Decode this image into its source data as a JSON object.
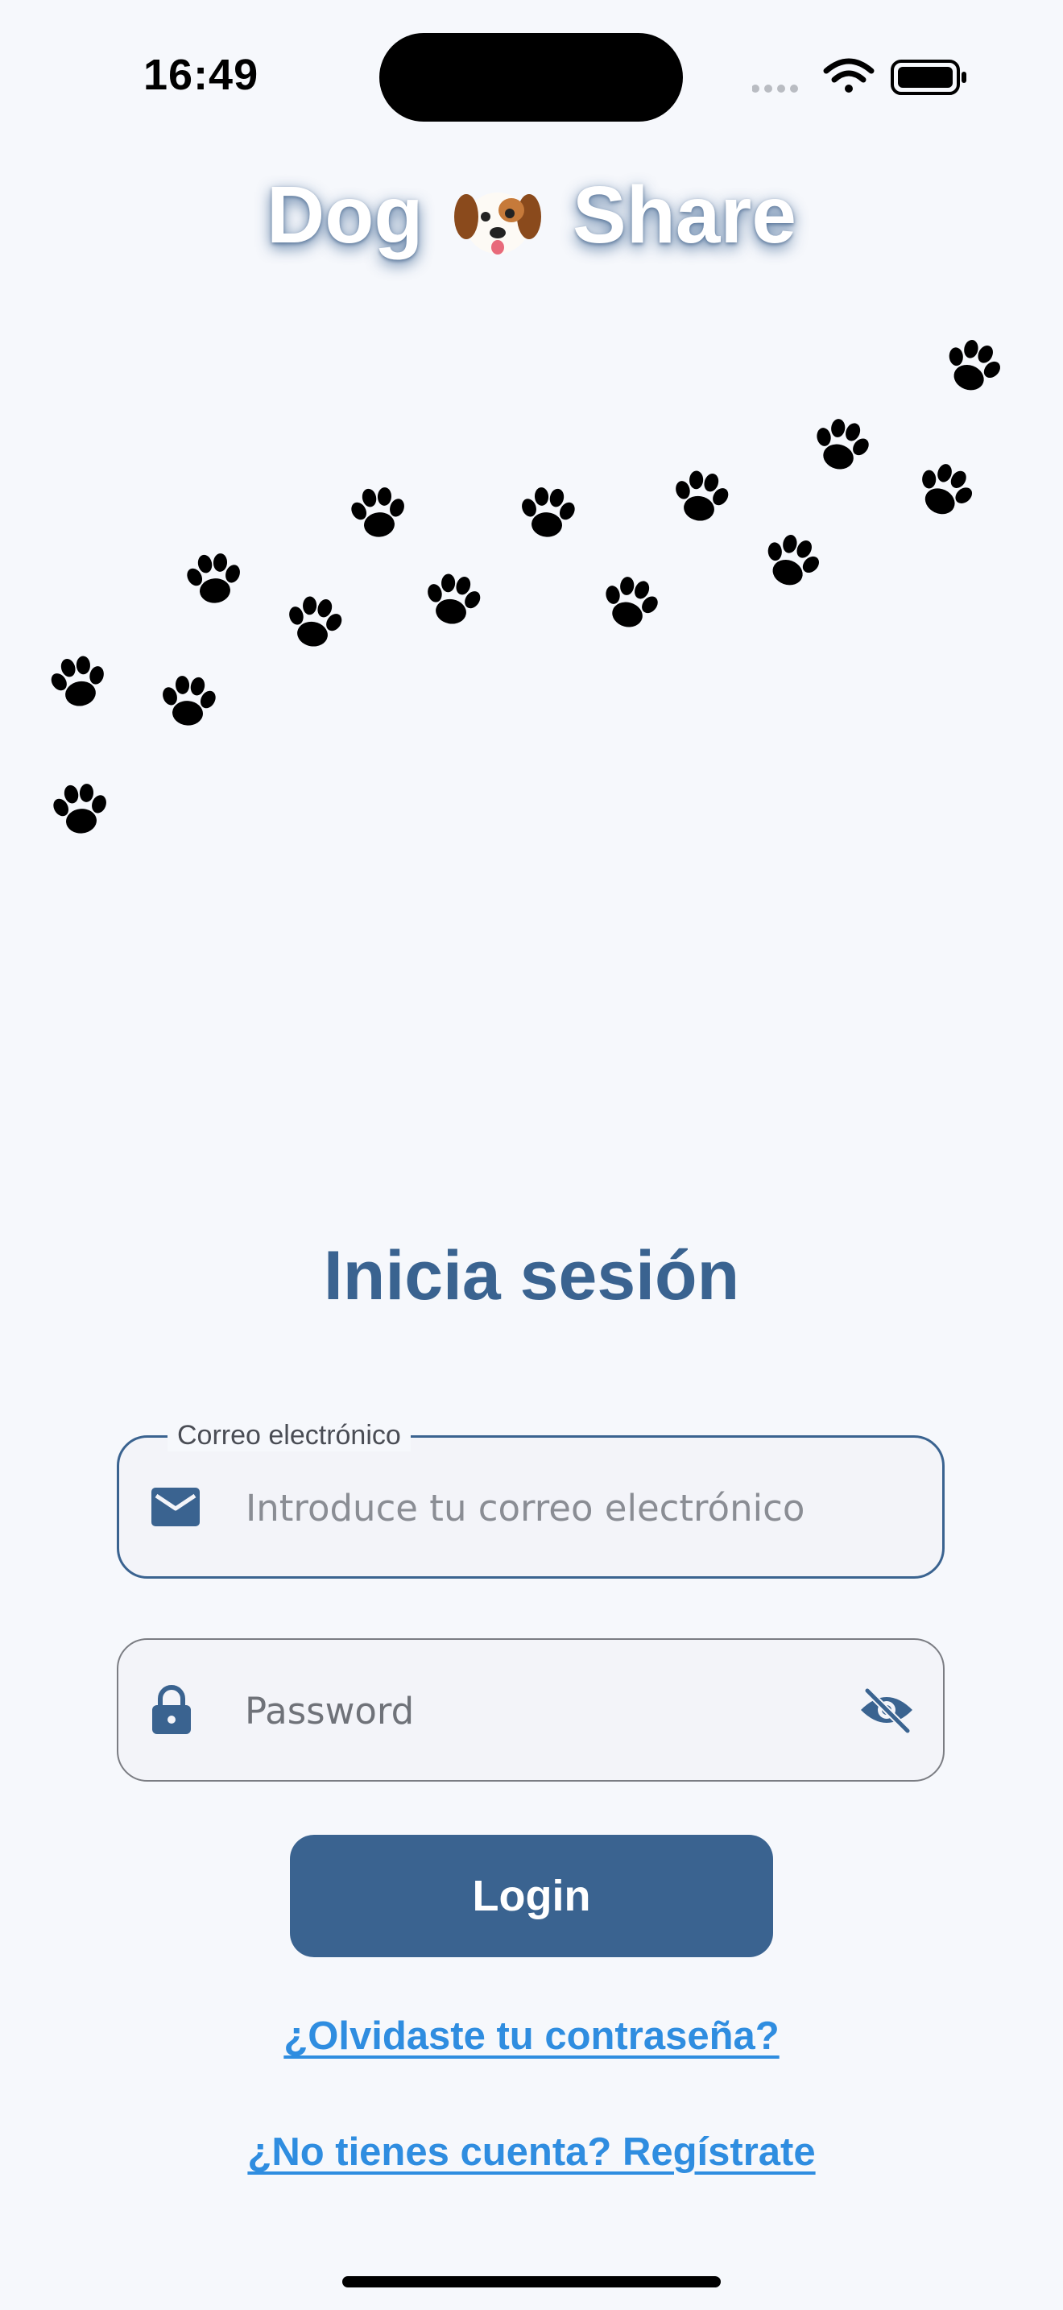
{
  "status_bar": {
    "time": "16:49",
    "icons": [
      "signal-dots-icon",
      "wifi-icon",
      "battery-icon"
    ]
  },
  "app": {
    "title_left": "Dog",
    "title_right": "Share",
    "title_emoji": "dog-face-icon",
    "decoration": "paw-prints-icon"
  },
  "login": {
    "heading": "Inicia sesión",
    "email": {
      "label": "Correo electrónico",
      "placeholder": "Introduce tu correo electrónico",
      "value": "",
      "icon": "mail-icon"
    },
    "password": {
      "placeholder": "Password",
      "value": "",
      "icon": "lock-icon",
      "toggle_icon": "eye-off-icon"
    },
    "button_label": "Login",
    "forgot_link": "¿Olvidaste tu contraseña?",
    "register_link": "¿No tienes cuenta? Regístrate"
  },
  "colors": {
    "primary": "#3a6390",
    "link": "#2f8de0",
    "background": "#f6f8fc",
    "field_background": "#f3f4f9"
  }
}
